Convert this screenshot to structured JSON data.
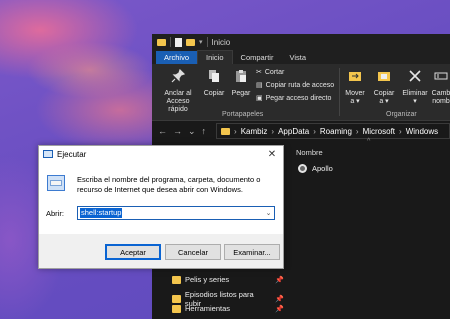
{
  "explorer": {
    "title": "Inicio",
    "tabs": [
      "Archivo",
      "Inicio",
      "Compartir",
      "Vista"
    ],
    "ribbon": {
      "pin_label_1": "Anclar al",
      "pin_label_2": "Acceso rápido",
      "copy_label": "Copiar",
      "paste_label": "Pegar",
      "cut_label": "Cortar",
      "copy_path_label": "Copiar ruta de acceso",
      "paste_shortcut_label": "Pegar acceso directo",
      "clipboard_group": "Portapapeles",
      "move_label_1": "Mover",
      "move_label_2": "a ▾",
      "copyto_label_1": "Copiar",
      "copyto_label_2": "a ▾",
      "delete_label_1": "Eliminar",
      "delete_label_2": "▾",
      "rename_label_1": "Camb",
      "rename_label_2": "nomb",
      "organize_group": "Organizar"
    },
    "address": {
      "back": "←",
      "forward": "→",
      "recent": "⌄",
      "up": "↑",
      "separator": "›",
      "crumbs": [
        "Kambiz",
        "AppData",
        "Roaming",
        "Microsoft",
        "Windows"
      ]
    },
    "column_header": "Nombre",
    "files": [
      {
        "name": "Apollo"
      }
    ],
    "nav_items": [
      {
        "label": "Pelis y series"
      },
      {
        "label": "Episodios listos para subir"
      },
      {
        "label": "Herramientas"
      }
    ]
  },
  "run_dialog": {
    "title": "Ejecutar",
    "close": "✕",
    "description": "Escriba el nombre del programa, carpeta, documento o recurso de Internet que desea abrir con Windows.",
    "open_label": "Abrir:",
    "input_value": "shell:startup",
    "buttons": {
      "ok": "Aceptar",
      "cancel": "Cancelar",
      "browse": "Examinar..."
    }
  },
  "colors": {
    "accent": "#1a5fb4",
    "folder": "#f3c54d",
    "selection": "#0a64d2"
  }
}
